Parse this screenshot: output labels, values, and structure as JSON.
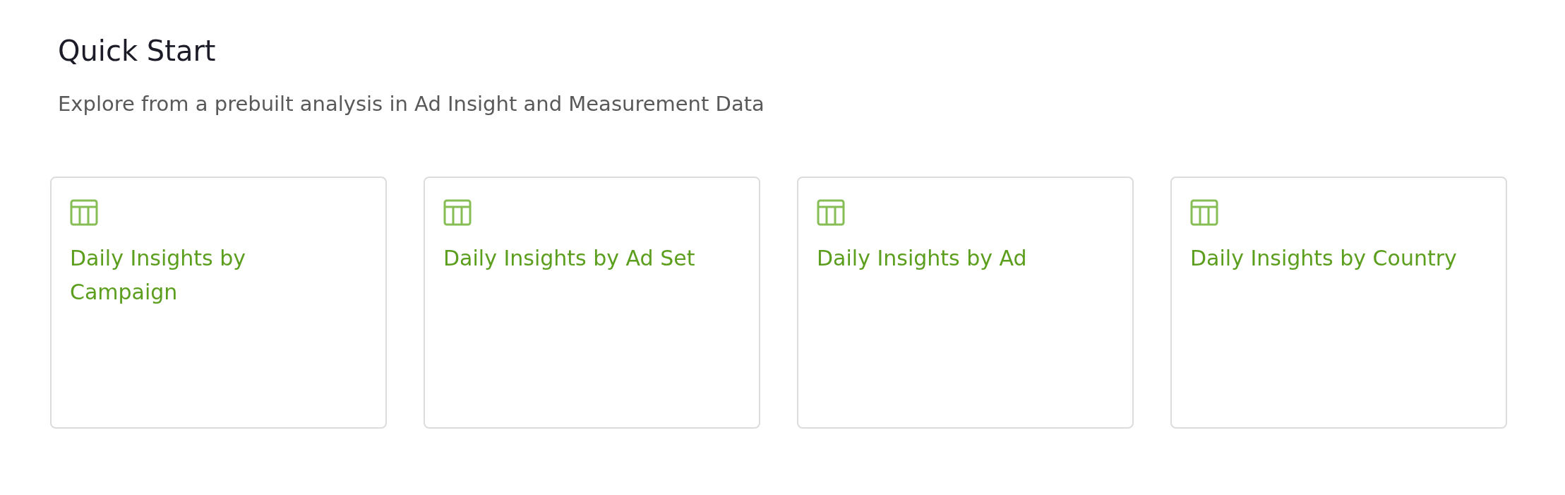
{
  "header": {
    "title": "Quick Start",
    "subtitle": "Explore from a prebuilt analysis in Ad Insight and Measurement Data"
  },
  "cards": [
    {
      "kind": "table",
      "title": "Daily Insights by Campaign"
    },
    {
      "kind": "table",
      "title": "Daily Insights by Ad Set"
    },
    {
      "kind": "table",
      "title": "Daily Insights by Ad"
    },
    {
      "kind": "table",
      "title": "Daily Insights by Country"
    }
  ]
}
